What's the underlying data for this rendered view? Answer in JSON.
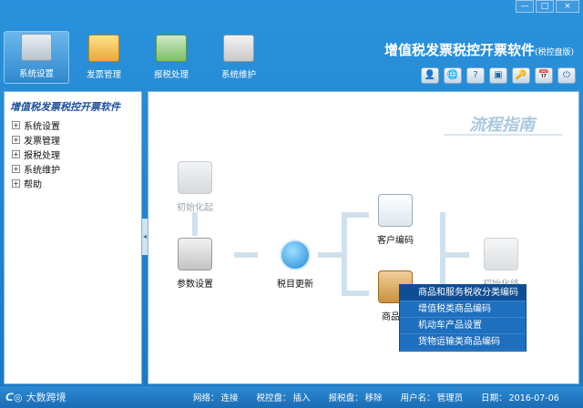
{
  "titlebar": {
    "minimize": "—",
    "maximize": "□",
    "close": "×"
  },
  "toolbar": {
    "items": [
      {
        "label": "系统设置",
        "icon": "settings-panel-icon",
        "active": true
      },
      {
        "label": "发票管理",
        "icon": "invoice-folder-icon",
        "active": false
      },
      {
        "label": "报税处理",
        "icon": "tax-report-icon",
        "active": false
      },
      {
        "label": "系统维护",
        "icon": "maintenance-tools-icon",
        "active": false
      }
    ]
  },
  "app": {
    "title": "增值税发票税控开票软件",
    "edition": "(税控盘版)"
  },
  "quick_icons": [
    {
      "glyph": "👤",
      "icon": "user-icon"
    },
    {
      "glyph": "🌐",
      "icon": "network-icon"
    },
    {
      "glyph": "?",
      "icon": "help-icon"
    },
    {
      "glyph": "▣",
      "icon": "window-icon"
    },
    {
      "glyph": "🔑",
      "icon": "key-icon"
    },
    {
      "glyph": "📅",
      "icon": "calendar-icon"
    },
    {
      "glyph": "⏻",
      "icon": "exit-icon"
    }
  ],
  "sidebar": {
    "title": "增值税发票税控开票软件",
    "items": [
      {
        "label": "系统设置"
      },
      {
        "label": "发票管理"
      },
      {
        "label": "报税处理"
      },
      {
        "label": "系统维护"
      },
      {
        "label": "帮助"
      }
    ]
  },
  "main": {
    "guide_title": "流程指南",
    "nodes": {
      "init": "初始化起",
      "param": "参数设置",
      "tax_update": "税目更新",
      "customer": "客户编码",
      "goods": "商品编",
      "final": "初始化终"
    }
  },
  "context_menu": {
    "items": [
      "商品和服务税收分类编码",
      "增值税类商品编码",
      "机动车产品设置",
      "货物运输类商品编码"
    ]
  },
  "statusbar": {
    "brand": "大数跨境",
    "network_label": "网络：",
    "network_value": "连接",
    "taxdisk_label": "税控盘：",
    "taxdisk_value": "插入",
    "reportdisk_label": "报税盘：",
    "reportdisk_value": "移除",
    "user_label": "用户名：",
    "user_value": "管理员",
    "date_label": "日期：",
    "date_value": "2016-07-06"
  },
  "colors": {
    "frame": "#1f7fcc",
    "menu": "#1f6fbf",
    "title_accent": "#1a4e9a"
  }
}
